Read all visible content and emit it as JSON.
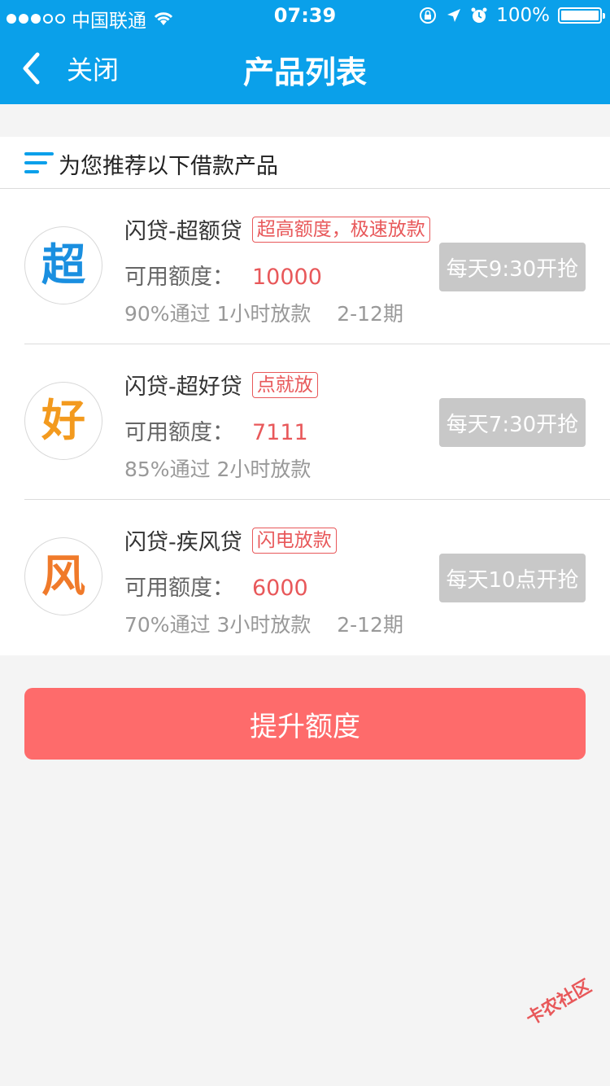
{
  "status_bar": {
    "carrier": "中国联通",
    "time": "07:39",
    "battery": "100%"
  },
  "nav": {
    "back_label": "关闭",
    "title": "产品列表"
  },
  "recommend": {
    "title": "为您推荐以下借款产品"
  },
  "products": [
    {
      "logo_char": "超",
      "logo_color": "#1a8fe0",
      "name": "闪贷-超额贷",
      "tag": "超高额度，极速放款",
      "quota_label": "可用额度：",
      "quota_value": "10000",
      "meta": "90%通过 1小时放款    2-12期",
      "button": "每天9:30开抢"
    },
    {
      "logo_char": "好",
      "logo_color": "#f39a1e",
      "name": "闪贷-超好贷",
      "tag": "点就放",
      "quota_label": "可用额度：",
      "quota_value": "7111",
      "meta": "85%通过 2小时放款",
      "button": "每天7:30开抢"
    },
    {
      "logo_char": "风",
      "logo_color": "#f07a2a",
      "name": "闪贷-疾风贷",
      "tag": "闪电放款",
      "quota_label": "可用额度：",
      "quota_value": "6000",
      "meta": "70%通过 3小时放款    2-12期",
      "button": "每天10点开抢"
    }
  ],
  "boost_button": "提升额度",
  "watermark": "卡农社区",
  "colors": {
    "header_bg": "#0aa0ea",
    "accent_red": "#e8585a",
    "boost_bg": "#fe6b6b",
    "disabled_btn": "#c8c8c8"
  }
}
